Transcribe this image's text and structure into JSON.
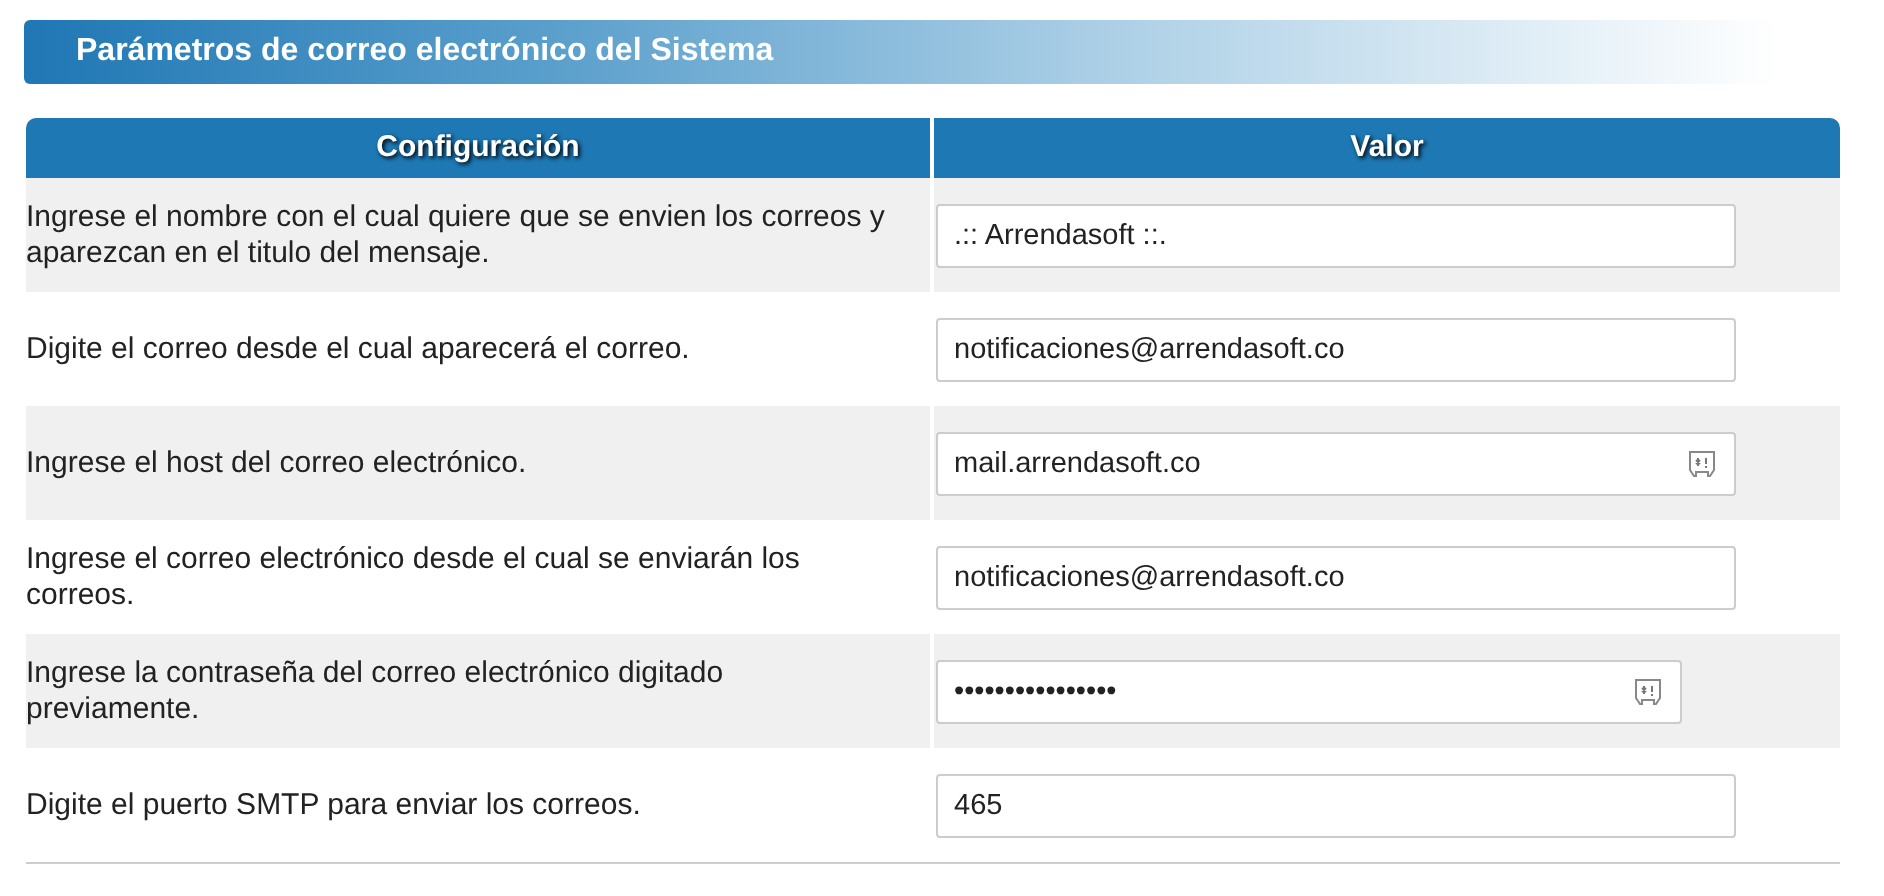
{
  "title": "Parámetros de correo electrónico del Sistema",
  "table": {
    "columns": [
      "Configuración",
      "Valor"
    ],
    "rows": [
      {
        "label": "Ingrese el nombre con el cual quiere que se envien los correos y aparezcan en el titulo del mensaje.",
        "value": ".:: Arrendasoft ::.",
        "kind": "text",
        "autofill_icon": false
      },
      {
        "label": "Digite el correo desde el cual aparecerá el correo.",
        "value": "notificaciones@arrendasoft.co",
        "kind": "text",
        "autofill_icon": false
      },
      {
        "label": "Ingrese el host del correo electrónico.",
        "value": "mail.arrendasoft.co",
        "kind": "text",
        "autofill_icon": true
      },
      {
        "label": "Ingrese el correo electrónico desde el cual se enviarán los correos.",
        "value": "notificaciones@arrendasoft.co",
        "kind": "text",
        "autofill_icon": false
      },
      {
        "label": "Ingrese la contraseña del correo electrónico digitado previamente.",
        "value": "••••••••••••••••",
        "kind": "password",
        "autofill_icon": true
      },
      {
        "label": "Digite el puerto SMTP para enviar los correos.",
        "value": "465",
        "kind": "text",
        "autofill_icon": false
      }
    ]
  }
}
